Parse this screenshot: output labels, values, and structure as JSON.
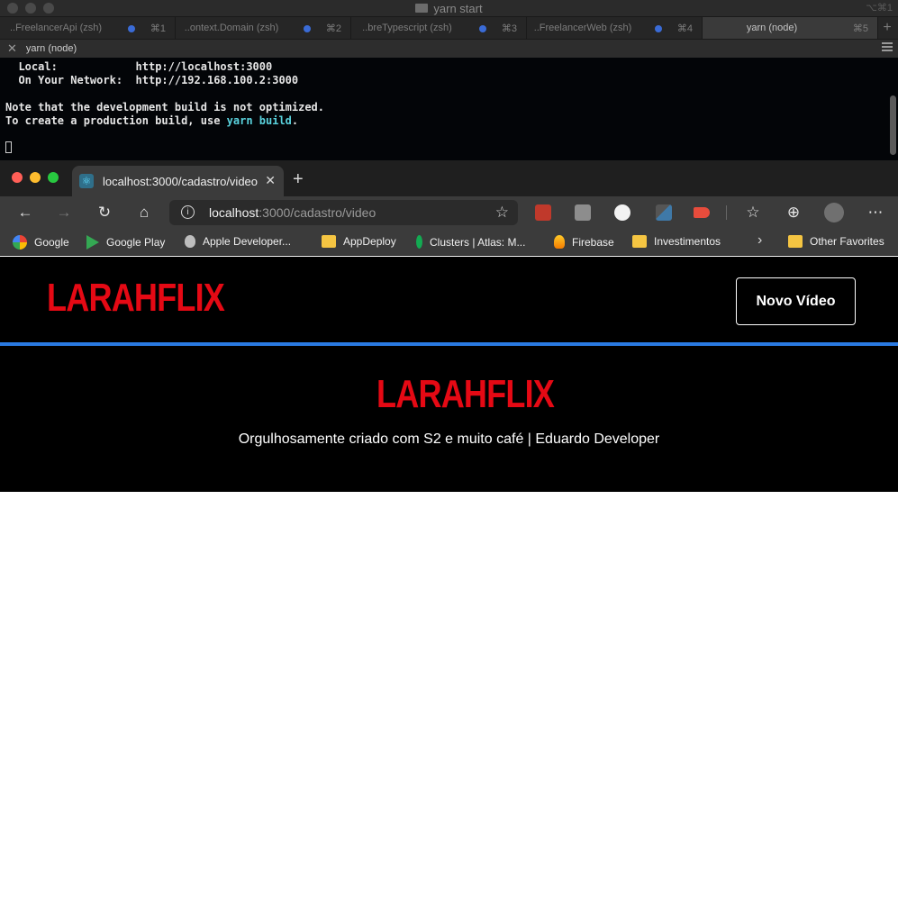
{
  "terminal": {
    "window_title": "yarn start",
    "title_shortcut": "⌥⌘1",
    "tabs": [
      {
        "label": "..FreelancerApi (zsh)",
        "shortcut": "⌘1"
      },
      {
        "label": "..ontext.Domain (zsh)",
        "shortcut": "⌘2"
      },
      {
        "label": "..breTypescript (zsh)",
        "shortcut": "⌘3"
      },
      {
        "label": "..FreelancerWeb (zsh)",
        "shortcut": "⌘4"
      },
      {
        "label": "yarn (node)",
        "shortcut": "⌘5"
      }
    ],
    "session_label": "yarn (node)",
    "output": {
      "local_label": "Local:",
      "local_url": "http://localhost:3000",
      "network_label": "On Your Network:",
      "network_url": "http://192.168.100.2:3000",
      "note_line": "Note that the development build is not optimized.",
      "prod_prefix": "To create a production build, use ",
      "prod_cmd": "yarn build",
      "prod_suffix": "."
    }
  },
  "browser": {
    "tab_title": "localhost:3000/cadastro/video",
    "address": {
      "host": "localhost",
      "path": ":3000/cadastro/video"
    },
    "bookmarks": [
      {
        "label": "Google",
        "icon": "google-icon"
      },
      {
        "label": "Google Play",
        "icon": "google-play-icon"
      },
      {
        "label": "Apple Developer...",
        "icon": "apple-icon"
      },
      {
        "label": "AppDeploy",
        "icon": "folder-icon"
      },
      {
        "label": "Clusters | Atlas: M...",
        "icon": "mongodb-leaf-icon"
      },
      {
        "label": "Firebase",
        "icon": "firebase-icon"
      },
      {
        "label": "Investimentos",
        "icon": "folder-icon"
      }
    ],
    "other_favorites": "Other Favorites"
  },
  "page": {
    "brand": "LARAHFLIX",
    "new_video_button": "Novo Vídeo",
    "footer_text": "Orgulhosamente criado com S2 e muito café | Eduardo Developer",
    "colors": {
      "brand_red": "#e50914",
      "divider_blue": "#2a7ae2",
      "background": "#000000"
    }
  }
}
